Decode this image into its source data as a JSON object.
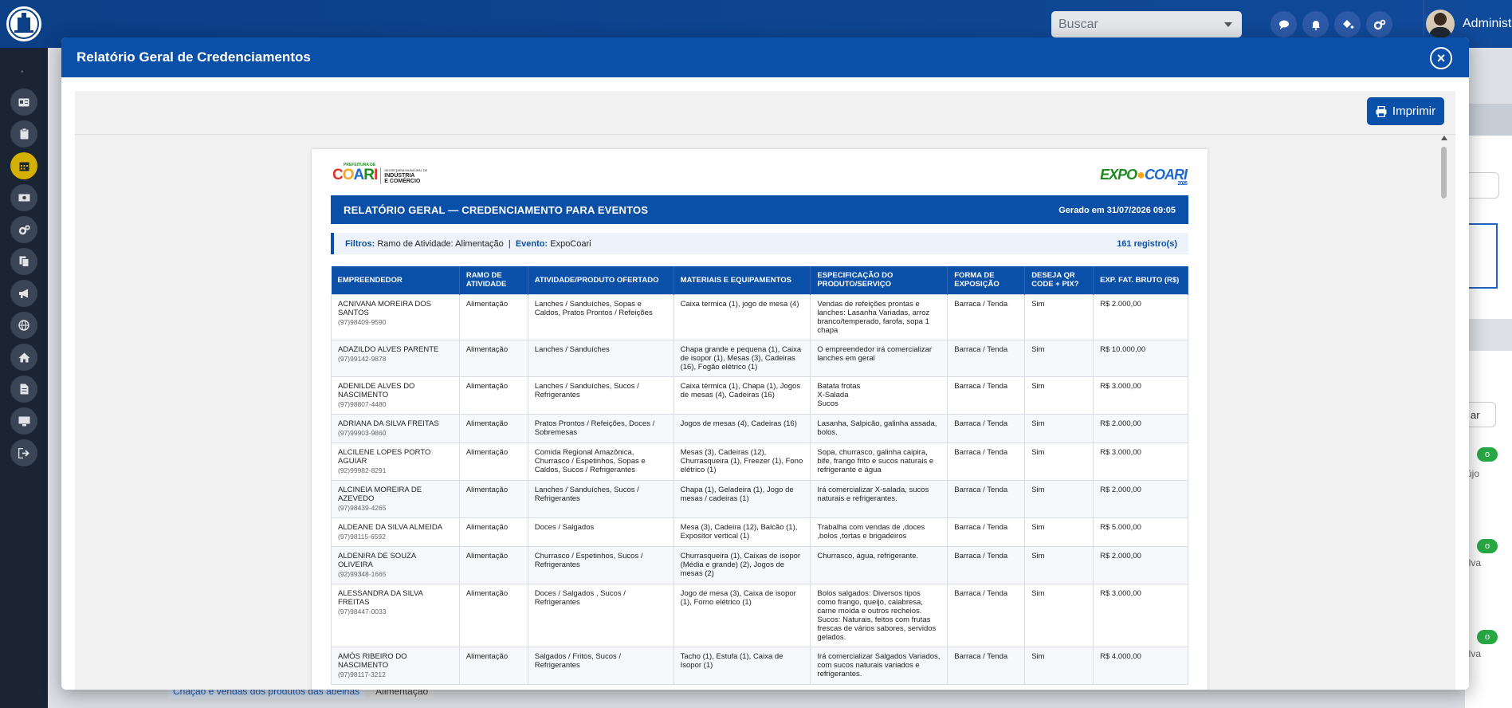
{
  "topbar": {
    "search_placeholder": "Buscar",
    "user_name": "Administ..."
  },
  "sidebar": {
    "items": [
      "id-card-icon",
      "clipboard-icon",
      "calendar-icon",
      "money-icon",
      "cogs-icon",
      "copy-icon",
      "bullhorn-icon",
      "globe-icon",
      "home-icon",
      "file-icon",
      "desktop-icon",
      "sign-out-icon"
    ],
    "active_index": 2
  },
  "background": {
    "tag1": "Criação e vendas dos produtos das abelhas",
    "tag2": "Alimentação",
    "side_btn": "ar",
    "badge": "o",
    "texts": [
      "újo",
      "ilva",
      "ilva"
    ]
  },
  "modal": {
    "title": "Relatório Geral de Credenciamentos",
    "close": "×",
    "print_label": "Imprimir"
  },
  "report": {
    "logo_left_word": "COARI",
    "logo_left_prefix": "PREFEITURA DE",
    "logo_left_sub1": "SECRETARIA MUNICIPAL DE",
    "logo_left_sub2": "INDÚSTRIA",
    "logo_left_sub3": "E COMÉRCIO",
    "logo_right_word": "EXPOCOARI",
    "logo_right_year": "2026",
    "title": "RELATÓRIO GERAL — CREDENCIAMENTO PARA EVENTOS",
    "generated": "Gerado em 31/07/2026 09:05",
    "filter_label1": "Filtros:",
    "filter_value1": "Ramo de Atividade: Alimentação",
    "filter_sep": "|",
    "filter_label2": "Evento:",
    "filter_value2": "ExpoCoari",
    "count": "161 registro(s)",
    "columns": [
      "EMPREENDEDOR",
      "RAMO DE ATIVIDADE",
      "ATIVIDADE/PRODUTO OFERTADO",
      "MATERIAIS E EQUIPAMENTOS",
      "ESPECIFICAÇÃO DO PRODUTO/SERVIÇO",
      "FORMA DE EXPOSIÇÃO",
      "DESEJA QR CODE + PIX?",
      "EXP. FAT. BRUTO (R$)"
    ],
    "rows": [
      {
        "name": "ACNIVANA MOREIRA DOS SANTOS",
        "phone": "(97)98409-9590",
        "ramo": "Alimentação",
        "atividade": "Lanches / Sanduíches, Sopas e Caldos, Pratos Prontos / Refeições",
        "materiais": "Caixa termica (1), jogo de mesa (4)",
        "espec": "Vendas de refeições prontas e lanches: Lasanha Variadas, arroz branco/temperado, farofa, sopa 1 chapa",
        "forma": "Barraca / Tenda",
        "qr": "Sim",
        "fat": "R$ 2.000,00"
      },
      {
        "name": "ADAZILDO ALVES PARENTE",
        "phone": "(97)99142-9878",
        "ramo": "Alimentação",
        "atividade": "Lanches / Sanduíches",
        "materiais": "Chapa grande e pequena (1), Caixa de isopor (1), Mesas (3), Cadeiras (16), Fogão elétrico (1)",
        "espec": "O empreendedor irá comercializar lanches em geral",
        "forma": "Barraca / Tenda",
        "qr": "Sim",
        "fat": "R$ 10.000,00"
      },
      {
        "name": "ADENILDE ALVES DO NASCIMENTO",
        "phone": "(97)98807-4480",
        "ramo": "Alimentação",
        "atividade": "Lanches / Sanduíches, Sucos / Refrigerantes",
        "materiais": "Caixa térmica (1), Chapa (1), Jogos de mesas (4), Cadeiras (16)",
        "espec": "Batata frotas\nX-Salada\nSucos",
        "forma": "Barraca / Tenda",
        "qr": "Sim",
        "fat": "R$ 3.000,00"
      },
      {
        "name": "ADRIANA DA SILVA FREITAS",
        "phone": "(97)99903-9860",
        "ramo": "Alimentação",
        "atividade": "Pratos Prontos / Refeições, Doces / Sobremesas",
        "materiais": "Jogos de mesas (4), Cadeiras (16)",
        "espec": "Lasanha, Salpicão, galinha assada, bolos.",
        "forma": "Barraca / Tenda",
        "qr": "Sim",
        "fat": "R$ 2.000,00"
      },
      {
        "name": "ALCILENE LOPES PORTO AGUIAR",
        "phone": "(92)99982-8291",
        "ramo": "Alimentação",
        "atividade": "Comida Regional Amazônica, Churrasco / Espetinhos, Sopas e Caldos, Sucos / Refrigerantes",
        "materiais": "Mesas (3), Cadeiras (12), Churrasqueira (1), Freezer (1), Fono elétrico (1)",
        "espec": "Sopa, churrasco, galinha caipira, bife, frango frito e sucos naturais e refrigerante e água",
        "forma": "Barraca / Tenda",
        "qr": "Sim",
        "fat": "R$ 3.000,00"
      },
      {
        "name": "ALCINEIA MOREIRA DE AZEVEDO",
        "phone": "(97)98439-4265",
        "ramo": "Alimentação",
        "atividade": "Lanches / Sanduíches, Sucos / Refrigerantes",
        "materiais": "Chapa (1), Geladeira (1), Jogo de mesas / cadeiras (1)",
        "espec": "Irá comercializar X-salada, sucos naturais e refrigerantes.",
        "forma": "Barraca / Tenda",
        "qr": "Sim",
        "fat": "R$ 2.000,00"
      },
      {
        "name": "ALDEANE DA SILVA ALMEIDA",
        "phone": "(97)98115-6592",
        "ramo": "Alimentação",
        "atividade": "Doces / Salgados",
        "materiais": "Mesa (3), Cadeira (12), Balcão (1), Expositor vertical (1)",
        "espec": "Trabalha com vendas de ,doces ,bolos ,tortas e brigadeiros",
        "forma": "Barraca / Tenda",
        "qr": "Sim",
        "fat": "R$ 5.000,00"
      },
      {
        "name": "ALDENIRA DE SOUZA OLIVEIRA",
        "phone": "(92)99348-1665",
        "ramo": "Alimentação",
        "atividade": "Churrasco / Espetinhos, Sucos / Refrigerantes",
        "materiais": "Churrasqueira (1), Caixas de isopor (Média e grande) (2), Jogos de mesas (2)",
        "espec": "Churrasco, água, refrigerante.",
        "forma": "Barraca / Tenda",
        "qr": "Sim",
        "fat": "R$ 2.000,00"
      },
      {
        "name": "ALESSANDRA DA SILVA FREITAS",
        "phone": "(97)98447-0033",
        "ramo": "Alimentação",
        "atividade": "Doces / Salgados , Sucos / Refrigerantes",
        "materiais": "Jogo de mesa (3), Caixa de isopor (1), Forno elétrico (1)",
        "espec": "Bolos salgados: Diversos tipos como frango, queijo, calabresa, carne moída e outros recheios. Sucos: Naturais, feitos com frutas frescas de vários sabores, servidos gelados.",
        "forma": "Barraca / Tenda",
        "qr": "Sim",
        "fat": "R$ 3.000,00"
      },
      {
        "name": "AMÓS RIBEIRO DO NASCIMENTO",
        "phone": "(97)98117-3212",
        "ramo": "Alimentação",
        "atividade": "Salgados / Fritos, Sucos / Refrigerantes",
        "materiais": "Tacho (1), Estufa (1), Caixa de Isopor (1)",
        "espec": "Irá comercializar Salgados Variados, com sucos naturais variados e refrigerantes.",
        "forma": "Barraca / Tenda",
        "qr": "Sim",
        "fat": "R$ 4.000,00"
      }
    ]
  }
}
